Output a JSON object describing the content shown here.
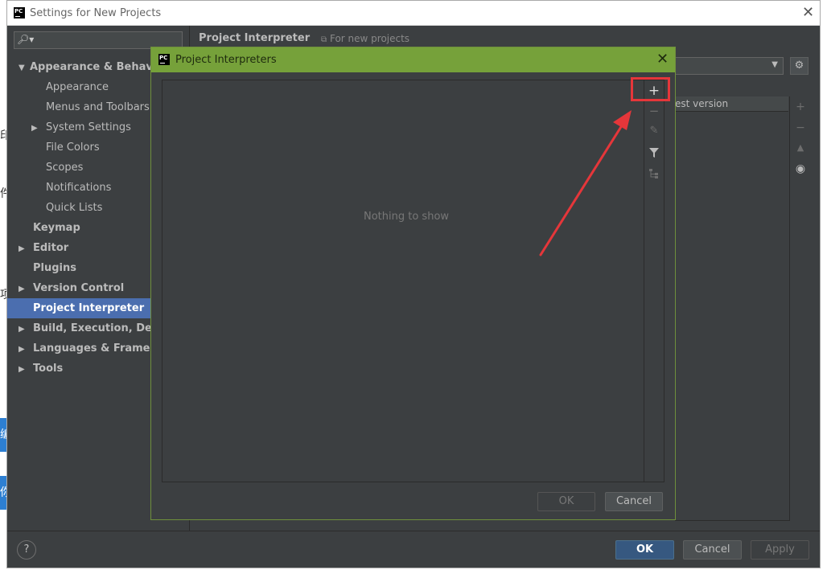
{
  "window": {
    "title": "Settings for New Projects",
    "logo_text": "PC"
  },
  "background_fragments": [
    "印",
    "件",
    "项",
    "编",
    "你"
  ],
  "search": {
    "icon": "search-icon",
    "placeholder": ""
  },
  "tree": {
    "items": [
      {
        "label": "Appearance & Behavior",
        "level": 0,
        "expandable": true,
        "expanded": true,
        "bold": true
      },
      {
        "label": "Appearance",
        "level": 1,
        "expandable": false,
        "bold": false
      },
      {
        "label": "Menus and Toolbars",
        "level": 1,
        "expandable": false,
        "bold": false
      },
      {
        "label": "System Settings",
        "level": 1,
        "expandable": true,
        "expanded": false,
        "bold": false
      },
      {
        "label": "File Colors",
        "level": 1,
        "expandable": false,
        "bold": false
      },
      {
        "label": "Scopes",
        "level": 1,
        "expandable": false,
        "bold": false
      },
      {
        "label": "Notifications",
        "level": 1,
        "expandable": false,
        "bold": false
      },
      {
        "label": "Quick Lists",
        "level": 1,
        "expandable": false,
        "bold": false
      },
      {
        "label": "Keymap",
        "level": 0,
        "expandable": false,
        "bold": true
      },
      {
        "label": "Editor",
        "level": 0,
        "expandable": true,
        "expanded": false,
        "bold": true
      },
      {
        "label": "Plugins",
        "level": 0,
        "expandable": false,
        "bold": true
      },
      {
        "label": "Version Control",
        "level": 0,
        "expandable": true,
        "expanded": false,
        "bold": true
      },
      {
        "label": "Project Interpreter",
        "level": 0,
        "expandable": false,
        "bold": true,
        "selected": true
      },
      {
        "label": "Build, Execution, Deployment",
        "level": 0,
        "expandable": true,
        "expanded": false,
        "bold": true
      },
      {
        "label": "Languages & Frameworks",
        "level": 0,
        "expandable": true,
        "expanded": false,
        "bold": true
      },
      {
        "label": "Tools",
        "level": 0,
        "expandable": true,
        "expanded": false,
        "bold": true
      }
    ]
  },
  "content": {
    "title": "Project Interpreter",
    "scope": "For new projects",
    "table_header_partial": "est version"
  },
  "footer": {
    "help": "?",
    "ok": "OK",
    "cancel": "Cancel",
    "apply": "Apply"
  },
  "dialog": {
    "title": "Project Interpreters",
    "empty_text": "Nothing to show",
    "ok": "OK",
    "cancel": "Cancel",
    "title_color": "#76a13a"
  },
  "colors": {
    "accent_selected": "#4b6eaf",
    "annotation_red": "#e5363a"
  }
}
